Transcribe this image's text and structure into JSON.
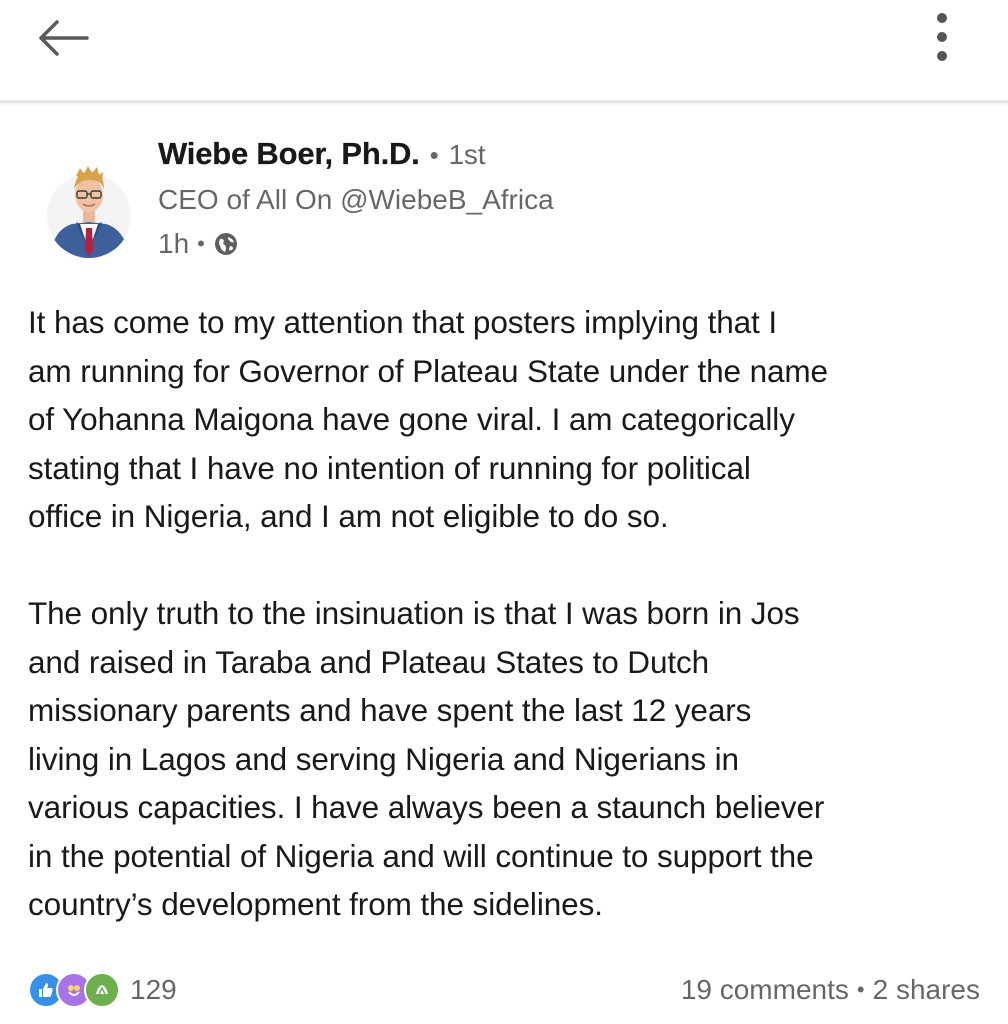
{
  "nav": {
    "back_icon": "arrow-left-icon",
    "more_icon": "more-vertical-icon"
  },
  "post": {
    "author": {
      "name": "Wiebe Boer, Ph.D.",
      "degree": "1st",
      "headline": "CEO of All On @WiebeB_Africa",
      "time": "1h",
      "visibility_icon": "globe-icon"
    },
    "paragraphs": [
      [
        "It has come to my attention that posters implying that I",
        "am running for Governor of Plateau State under the name",
        "of Yohanna Maigona have gone viral.  I am categorically",
        "stating that I have no intention of running for political",
        "office in Nigeria, and I am not eligible to do so."
      ],
      [
        "The only truth to the insinuation is that I was born in Jos",
        "and raised in Taraba and Plateau States to Dutch",
        "missionary parents and have spent the last 12 years",
        "living in Lagos and serving Nigeria and Nigerians in",
        "various capacities. I have always been a staunch believer",
        "in the potential of Nigeria and will continue to support the",
        "country’s development from the sidelines."
      ]
    ],
    "social": {
      "reactions_count": "129",
      "comments": "19 comments",
      "shares": "2 shares",
      "reaction_icons": [
        "like-icon",
        "celebrate-icon",
        "support-icon"
      ]
    }
  },
  "colors": {
    "text_primary": "#000000e6",
    "text_secondary": "#00000099",
    "like_blue": "#378fe9",
    "celebrate_purple": "#a872e8",
    "support_green": "#6dae4f"
  }
}
